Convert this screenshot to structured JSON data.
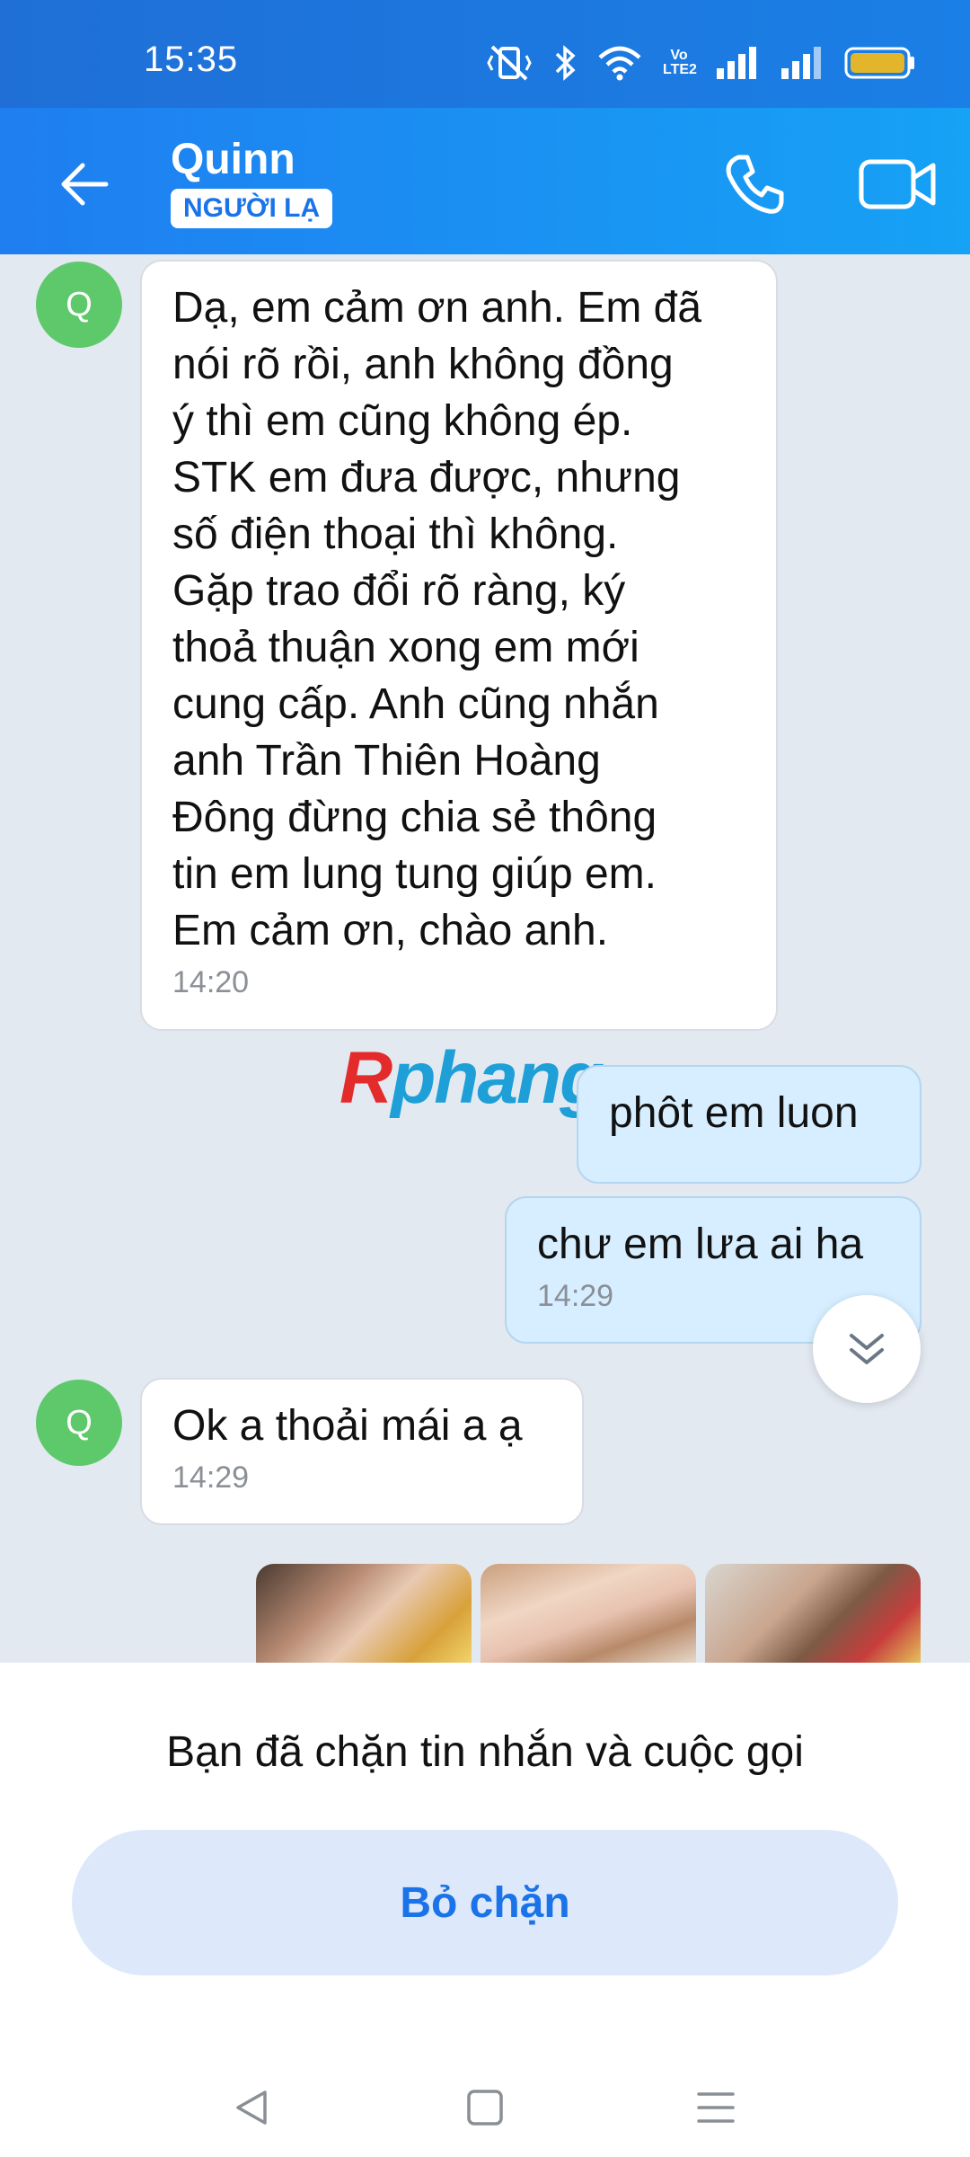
{
  "status_bar": {
    "time": "15:35",
    "icons": [
      "mute-vibrate-icon",
      "bluetooth-icon",
      "wifi-icon",
      "volte-icon",
      "signal-icon",
      "signal-icon",
      "battery-icon"
    ],
    "volte_label": "Vo LTE2"
  },
  "header": {
    "back_icon": "arrow-left-icon",
    "contact_name": "Quinn",
    "badge": "NGƯỜI LẠ",
    "call_icon": "phone-icon",
    "video_icon": "video-camera-icon"
  },
  "colors": {
    "header_gradient_start": "#1f7ef0",
    "header_gradient_end": "#16a2f5",
    "incoming_bubble": "#ffffff",
    "outgoing_bubble": "#d6eeff",
    "avatar": "#5ec96a",
    "accent": "#1a73e8"
  },
  "messages": [
    {
      "direction": "in",
      "avatar_initial": "Q",
      "lines": [
        "Dạ, em cảm ơn anh. Em đã",
        "nói rõ rồi, anh không đồng",
        "ý thì em cũng không ép.",
        "STK em đưa được, nhưng",
        "số điện thoại thì không.",
        "Gặp trao đổi rõ ràng, ký",
        "thoả thuận xong em mới",
        "cung cấp. Anh cũng nhắn",
        "anh Trần Thiên Hoàng",
        "Đông đừng chia sẻ thông",
        "tin em lung tung giúp em.",
        "Em cảm ơn, chào anh."
      ],
      "time": "14:20"
    },
    {
      "direction": "out",
      "text": "phôt em luon"
    },
    {
      "direction": "out",
      "text": "chư em lưa ai ha",
      "time": "14:29"
    },
    {
      "direction": "in",
      "avatar_initial": "Q",
      "text": "Ok a thoải mái a ạ",
      "time": "14:29"
    }
  ],
  "watermark": {
    "first": "R",
    "rest": "phang"
  },
  "scroll_button_icon": "double-chevron-down-icon",
  "photos": [
    "photo-1",
    "photo-2",
    "photo-3"
  ],
  "blocked": {
    "notice": "Bạn đã chặn tin nhắn và cuộc gọi",
    "unblock_label": "Bỏ chặn"
  },
  "nav": [
    "back-triangle-icon",
    "home-square-icon",
    "menu-lines-icon"
  ]
}
